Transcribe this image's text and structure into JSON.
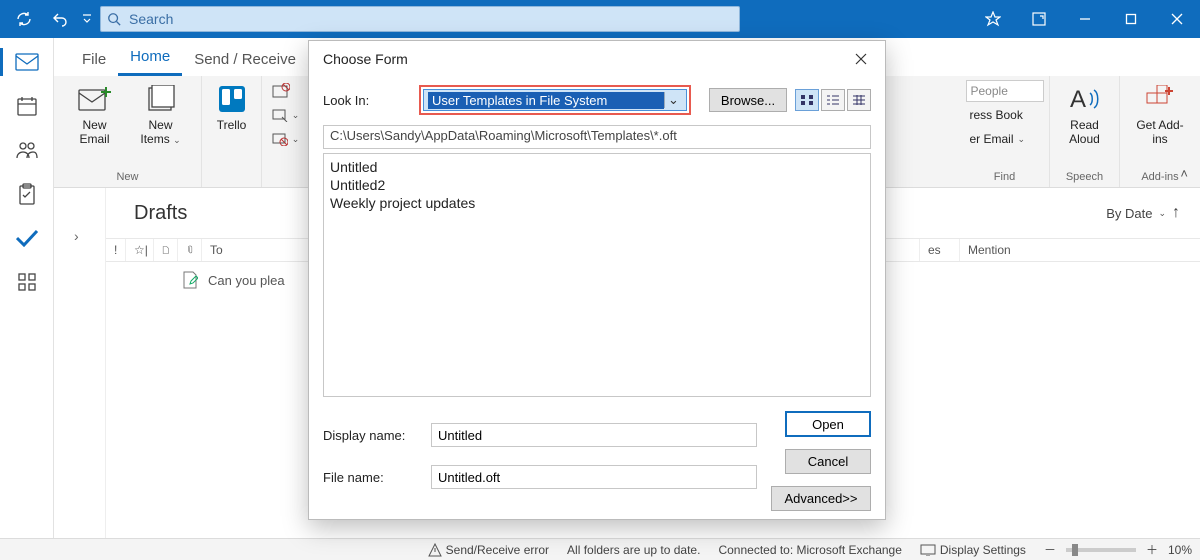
{
  "titlebar": {
    "search_placeholder": "Search"
  },
  "tabs": {
    "file": "File",
    "home": "Home",
    "sendreceive": "Send / Receive"
  },
  "ribbon": {
    "new_group": "New",
    "new_email": "New Email",
    "new_items": "New Items",
    "trello": "Trello",
    "people_search": "People",
    "address_book": "ress Book",
    "email_menu": "er Email",
    "find_group": "Find",
    "read_aloud": "Read Aloud",
    "speech_group": "Speech",
    "get_addins": "Get Add-ins",
    "addins_group": "Add-ins"
  },
  "list": {
    "folder": "Drafts",
    "sort": "By Date",
    "col_to": "To",
    "col_es": "es",
    "col_mention": "Mention",
    "row1_preview": "Can you plea"
  },
  "dialog": {
    "title": "Choose Form",
    "look_in_label": "Look In:",
    "look_in_value": "User Templates in File System",
    "browse": "Browse...",
    "path": "C:\\Users\\Sandy\\AppData\\Roaming\\Microsoft\\Templates\\*.oft",
    "items": [
      "Untitled",
      "Untitled2",
      "Weekly project updates"
    ],
    "display_name_label": "Display name:",
    "display_name_value": "Untitled",
    "file_name_label": "File name:",
    "file_name_value": "Untitled.oft",
    "open": "Open",
    "cancel": "Cancel",
    "advanced": "Advanced>>"
  },
  "status": {
    "error": "Send/Receive error",
    "uptodate": "All folders are up to date.",
    "connected": "Connected to: Microsoft Exchange",
    "display": "Display Settings",
    "zoom": "10%"
  }
}
